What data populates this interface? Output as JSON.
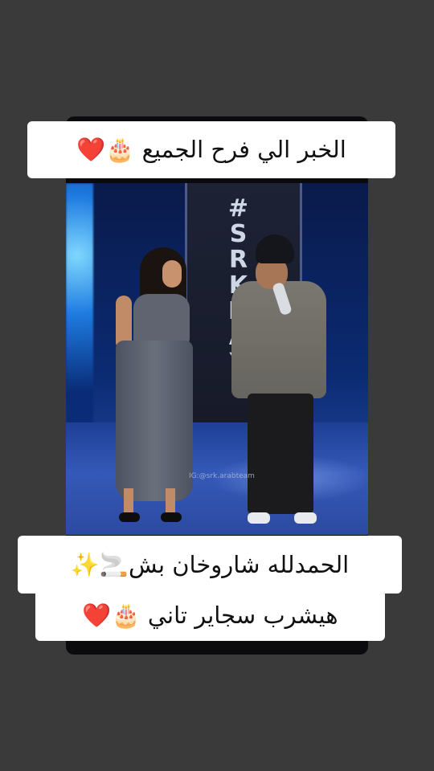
{
  "captions": {
    "top": "الخبر الي فرح الجميع 🎂❤️",
    "bottom_line1": "الحمدلله شاروخان بش🚬✨",
    "bottom_line2": "هيشرب سجاير تاني 🎂❤️"
  },
  "video": {
    "stage_sign_letters": [
      "#",
      "S",
      "R",
      "K",
      "D",
      "A",
      "Y"
    ],
    "watermark": "IG:@srk.arabteam"
  }
}
